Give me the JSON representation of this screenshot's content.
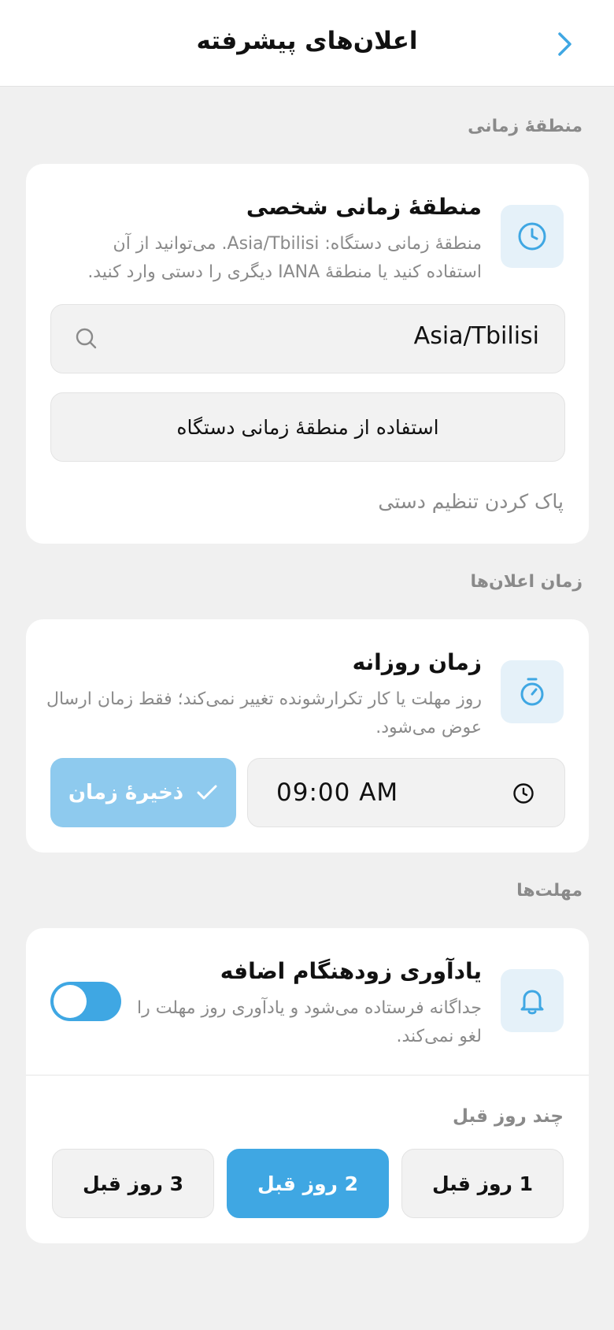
{
  "header": {
    "title": "اعلان‌های پیشرفته",
    "back_icon": "chevron-right-icon"
  },
  "colors": {
    "accent": "#3fa7e3",
    "accent_light": "#8ecaee",
    "icon_tile_bg": "#e5f1f9",
    "background": "#f0f0f0"
  },
  "timezone_section": {
    "label": "منطقهٔ زمانی",
    "title": "منطقهٔ زمانی شخصی",
    "description_line1": "منطقهٔ زمانی دستگاه: Asia/Tbilisi. می‌توانید از آن",
    "description_line2": "استفاده کنید یا منطقهٔ IANA دیگری را دستی وارد کنید.",
    "icon": "clock-icon",
    "input_value": "Asia/Tbilisi",
    "use_device_button": "استفاده از منطقهٔ زمانی دستگاه",
    "clear_link": "پاک کردن تنظیم دستی"
  },
  "notification_time_section": {
    "label": "زمان اعلان‌ها",
    "title": "زمان روزانه",
    "description_line1": "روز مهلت یا کار تکرارشونده تغییر نمی‌کند؛ فقط زمان ارسال",
    "description_line2": "عوض می‌شود.",
    "icon": "stopwatch-icon",
    "time_value": "09:00 AM",
    "save_button": "ذخیرهٔ زمان"
  },
  "deadlines_section": {
    "label": "مهلت‌ها",
    "title": "یادآوری زودهنگام اضافه",
    "description_line1": "جداگانه فرستاده می‌شود و یادآوری روز مهلت را",
    "description_line2": "لغو نمی‌کند.",
    "icon": "bell-icon",
    "toggle_on": true,
    "days_label": "چند روز قبل",
    "options": [
      {
        "label": "1 روز قبل",
        "selected": false
      },
      {
        "label": "2 روز قبل",
        "selected": true
      },
      {
        "label": "3 روز قبل",
        "selected": false
      }
    ]
  }
}
